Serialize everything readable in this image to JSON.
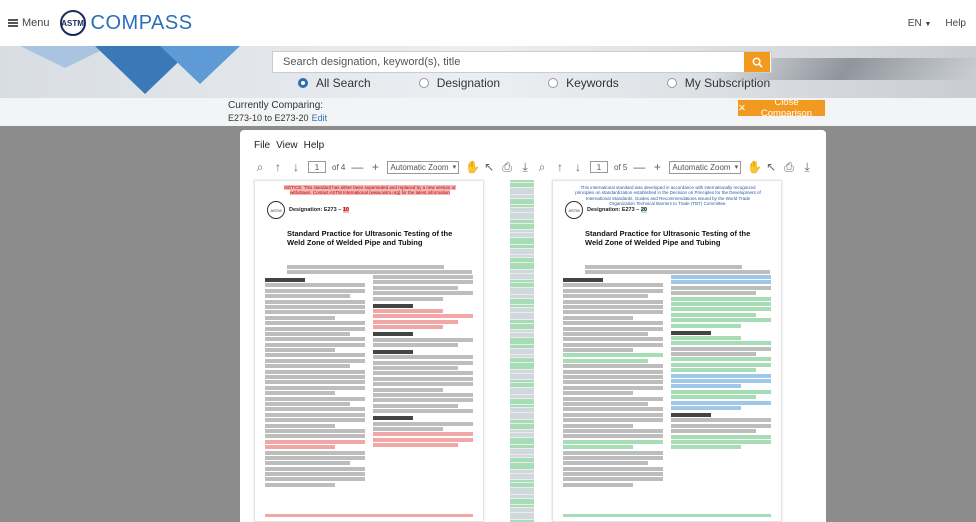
{
  "header": {
    "menu_label": "Menu",
    "logo_mark": "ASTM",
    "logo_text": "COMPASS",
    "language": "EN",
    "help": "Help"
  },
  "search": {
    "placeholder": "Search designation, keyword(s), title",
    "options": [
      {
        "label": "All Search",
        "checked": true
      },
      {
        "label": "Designation",
        "checked": false
      },
      {
        "label": "Keywords",
        "checked": false
      },
      {
        "label": "My Subscription",
        "checked": false
      }
    ]
  },
  "compare": {
    "label": "Currently Comparing:",
    "value": "E273-10 to E273-20",
    "edit": "Edit",
    "close_label": "Close Comparison"
  },
  "viewer": {
    "menu": [
      "File",
      "View",
      "Help"
    ],
    "left": {
      "page": "1",
      "total": "of 4",
      "zoom": "Automatic Zoom"
    },
    "right": {
      "page": "1",
      "total": "of 5",
      "zoom": "Automatic Zoom"
    }
  },
  "doc_left": {
    "notice": "NOTICE: This standard has either been superseded and replaced by a new version or withdrawn. Contact ASTM International (www.astm.org) for the latest information",
    "designation_prefix": "Designation: E273 –",
    "designation_year": "10",
    "title": "Standard Practice for Ultrasonic Testing of the Weld Zone of Welded Pipe and Tubing"
  },
  "doc_right": {
    "notice": "This international standard was developed in accordance with internationally recognized principles on standardization established in the Decision on Principles for the Development of International Standards, Guides and Recommendations issued by the World Trade Organization Technical Barriers to Trade (TBT) Committee.",
    "designation_prefix": "Designation: E273 –",
    "designation_year": "20",
    "title": "Standard Practice for Ultrasonic Testing of the Weld Zone of Welded Pipe and Tubing"
  },
  "colors": {
    "accent_orange": "#f29a1f",
    "brand_blue": "#2b6fb5",
    "diff_removed": "#f2a7a7",
    "diff_added": "#a6ddb4"
  }
}
